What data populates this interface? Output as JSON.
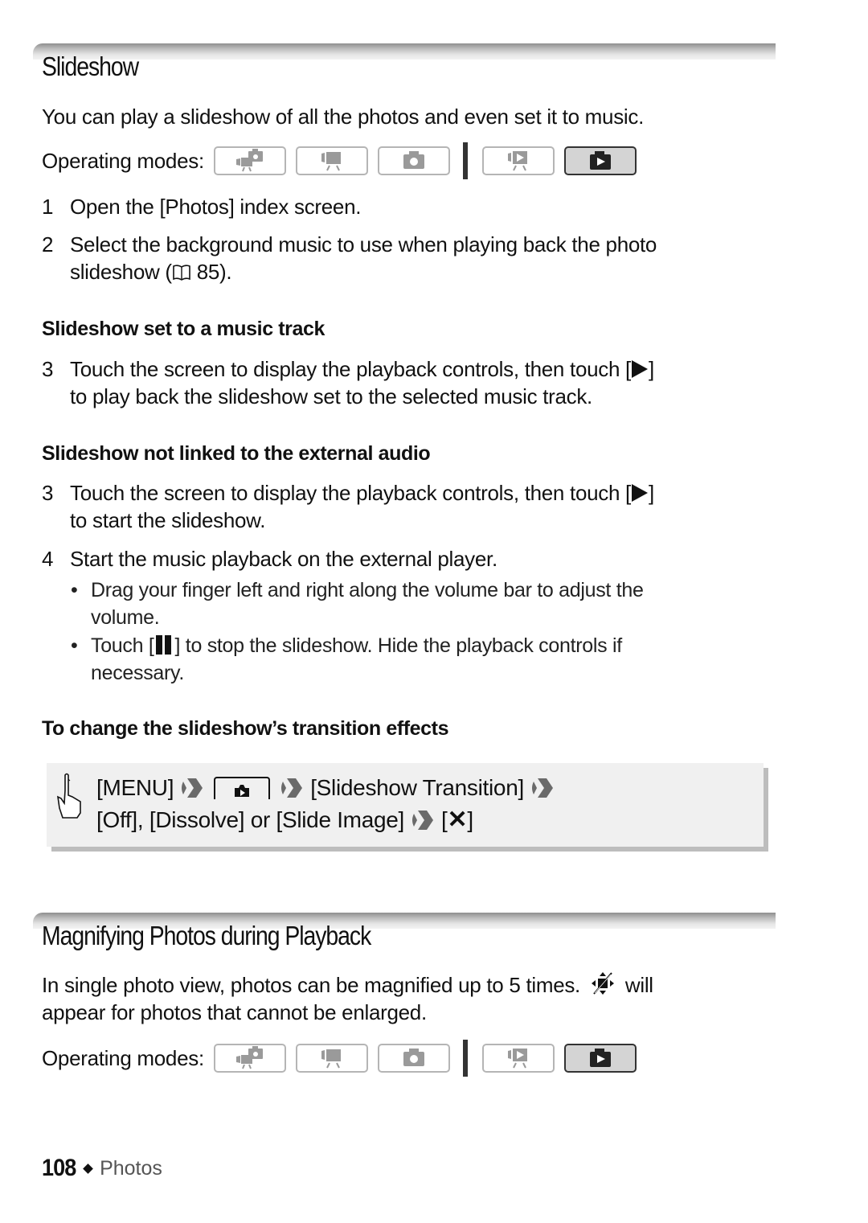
{
  "sections": [
    {
      "title": "Slideshow",
      "intro": "You can play a slideshow of all the photos and even set it to music.",
      "operating_modes_label": "Operating modes:",
      "steps_general": [
        {
          "num": "1",
          "text": "Open the [Photos] index screen."
        },
        {
          "num": "2",
          "text_line1": "Select the background music to use when playing back the photo",
          "text_line2_pre": "slideshow (",
          "page_ref": "85",
          "text_line2_post": ")."
        }
      ],
      "subsections": [
        {
          "heading": "Slideshow set to a music track",
          "steps": [
            {
              "num": "3",
              "line1_pre": "Touch the screen to display the playback controls, then touch [",
              "line1_post": "]",
              "line2": "to play back the slideshow set to the selected music track."
            }
          ]
        },
        {
          "heading": "Slideshow not linked to the external audio",
          "steps": [
            {
              "num": "3",
              "line1_pre": "Touch the screen to display the playback controls, then touch [",
              "line1_post": "]",
              "line2": "to start the slideshow."
            },
            {
              "num": "4",
              "line1": "Start the music playback on the external player."
            }
          ],
          "bullets": [
            {
              "line1": "Drag your finger left and right along the volume bar to adjust the",
              "line2": "volume."
            },
            {
              "line1_pre": "Touch [",
              "line1_post": "] to stop the slideshow. Hide the playback controls if",
              "line2": "necessary."
            }
          ]
        },
        {
          "heading": "To change the slideshow’s transition effects",
          "menu_path": {
            "line1": [
              "[MENU]",
              "[Slideshow Transition]"
            ],
            "line2": [
              "[Off], [Dissolve] or [Slide Image]",
              "["
            ],
            "line2_close": "]",
            "close_symbol": "✕"
          }
        }
      ]
    },
    {
      "title": "Magnifying Photos during Playback",
      "intro_line1_pre": "In single photo view, photos can be magnified up to 5 times.",
      "intro_line1_post": "will",
      "intro_line2": "appear for photos that cannot be enlarged.",
      "operating_modes_label": "Operating modes:"
    }
  ],
  "operating_modes": [
    {
      "name": "dual-shot",
      "active": false
    },
    {
      "name": "movie-recording",
      "active": false
    },
    {
      "name": "photo-recording",
      "active": false
    },
    {
      "name": "movie-playback",
      "active": false
    },
    {
      "name": "photo-playback",
      "active": true
    }
  ],
  "footer": {
    "page_number": "108",
    "chapter": "Photos"
  },
  "colors": {
    "mode_inactive": "#b5b5b5",
    "mode_active_bg": "#d4d4d4",
    "menu_box_bg": "#f0f0f0",
    "chevron": "#6a6a6a"
  }
}
